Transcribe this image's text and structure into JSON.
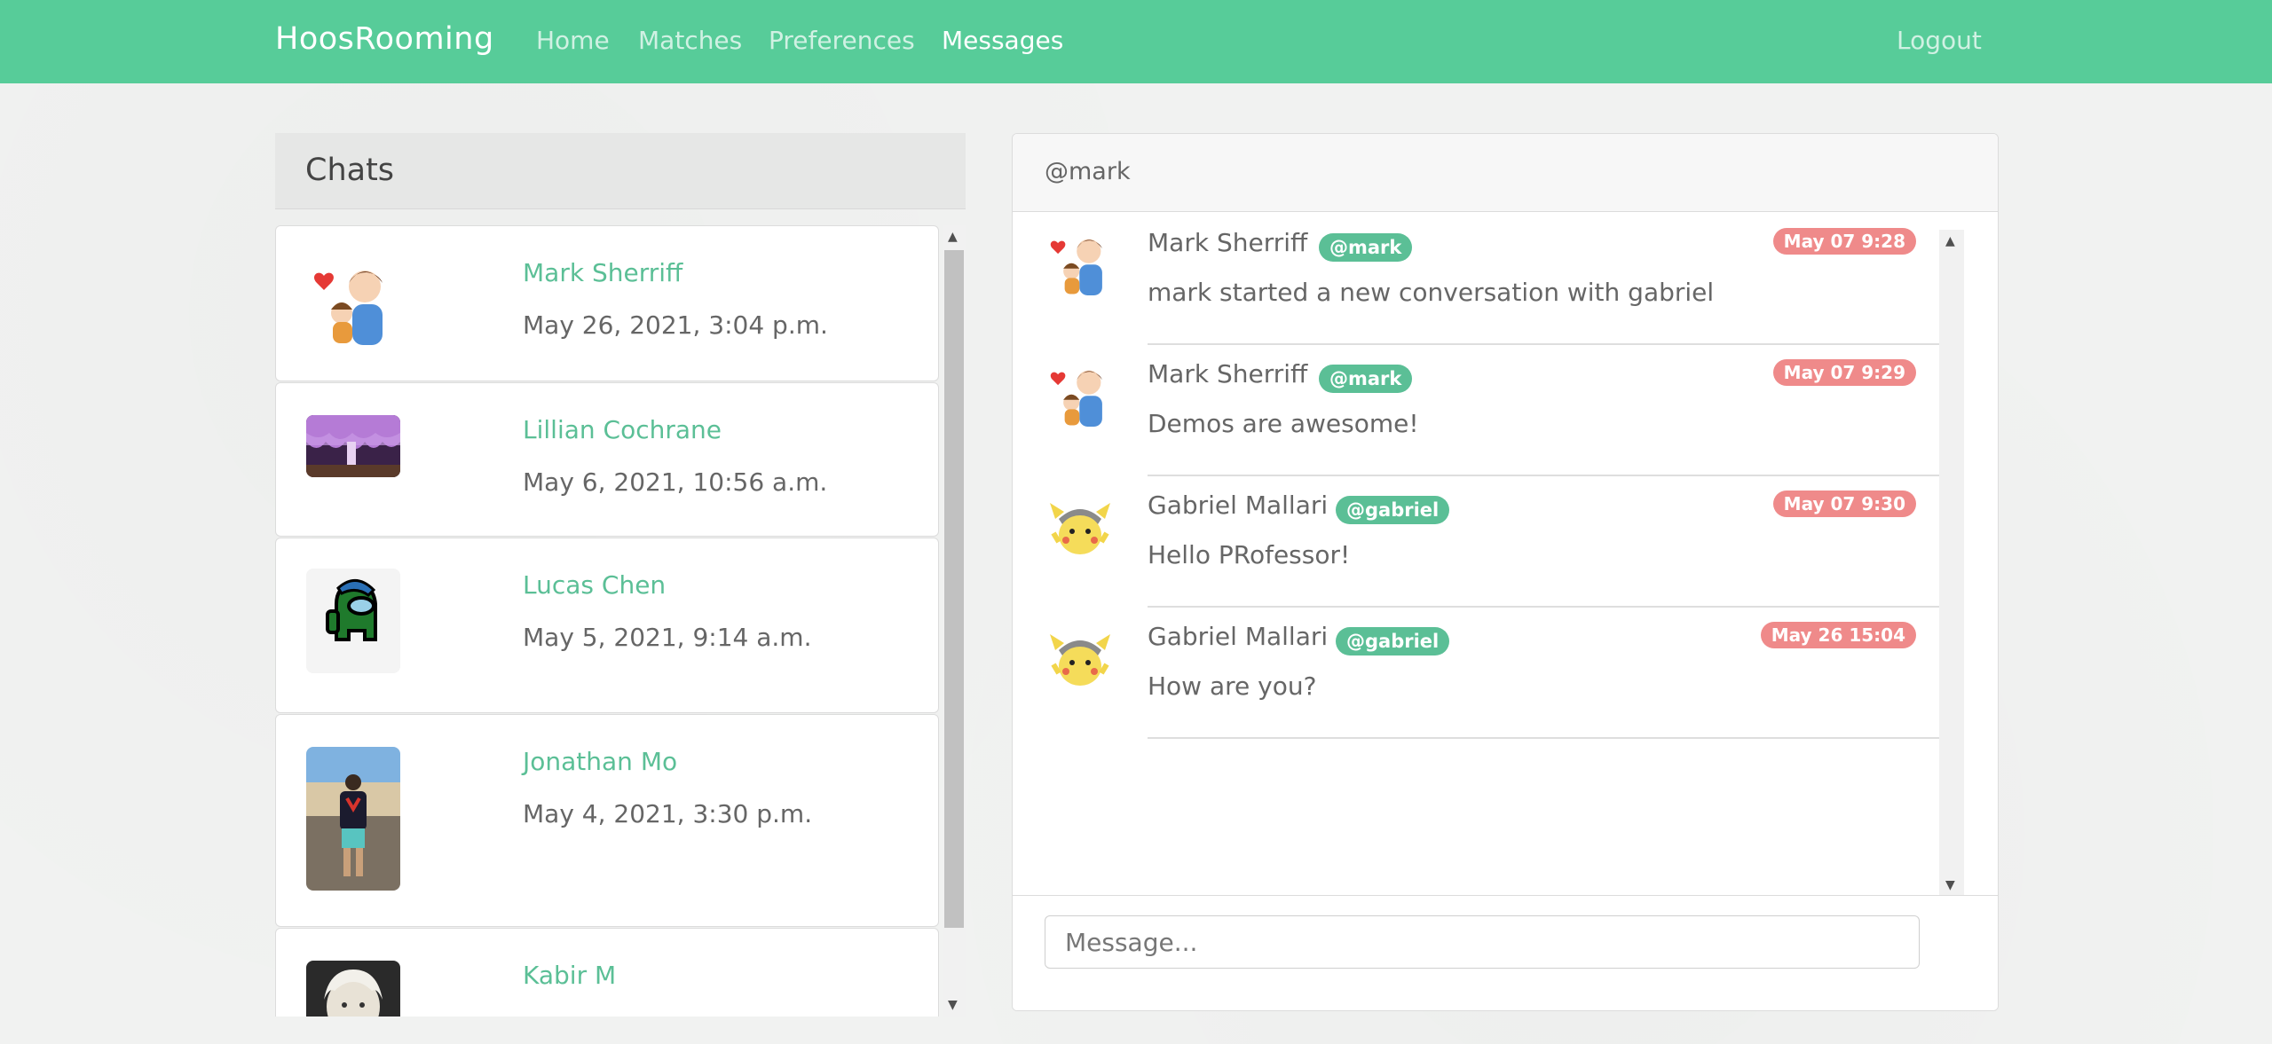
{
  "navbar": {
    "brand": "HoosRooming",
    "links": [
      "Home",
      "Matches",
      "Preferences",
      "Messages"
    ],
    "active": "Messages",
    "logout": "Logout",
    "color": "#57cc99"
  },
  "chats": {
    "title": "Chats",
    "items": [
      {
        "name": "Mark Sherriff",
        "date": "May 26, 2021, 3:04 p.m.",
        "avatar": "cartoon-dad-icon"
      },
      {
        "name": "Lillian Cochrane",
        "date": "May 6, 2021, 10:56 a.m.",
        "avatar": "wisteria-photo"
      },
      {
        "name": "Lucas Chen",
        "date": "May 5, 2021, 9:14 a.m.",
        "avatar": "among-us-icon"
      },
      {
        "name": "Jonathan Mo",
        "date": "May 4, 2021, 3:30 p.m.",
        "avatar": "person-photo"
      },
      {
        "name": "Kabir M",
        "date": "",
        "avatar": "portrait-photo"
      }
    ]
  },
  "conversation": {
    "header": "@mark",
    "messages": [
      {
        "name": "Mark Sherriff",
        "handle": "@mark",
        "time": "May 07 9:28",
        "text": "mark started a new conversation with gabriel",
        "avatar": "cartoon-dad-icon"
      },
      {
        "name": "Mark Sherriff",
        "handle": "@mark",
        "time": "May 07 9:29",
        "text": "Demos are awesome!",
        "avatar": "cartoon-dad-icon"
      },
      {
        "name": "Gabriel Mallari",
        "handle": "@gabriel",
        "time": "May 07 9:30",
        "text": "Hello PRofessor!",
        "avatar": "pikachu-icon"
      },
      {
        "name": "Gabriel Mallari",
        "handle": "@gabriel",
        "time": "May 26 15:04",
        "text": "How are you?",
        "avatar": "pikachu-icon"
      }
    ],
    "input_placeholder": "Message..."
  },
  "colors": {
    "accent": "#57cc99",
    "badge_green": "#5bbf96",
    "badge_red": "#ef8a8a"
  }
}
